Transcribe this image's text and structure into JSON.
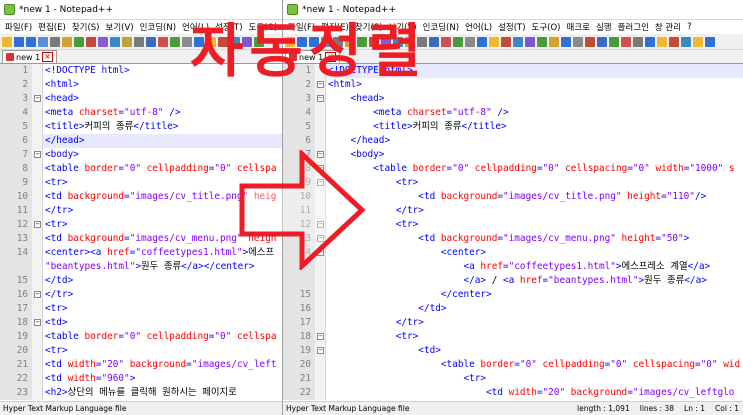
{
  "left_window": {
    "title": "*new 1 - Notepad++",
    "menu": [
      "파일(F)",
      "편집(E)",
      "찾기(S)",
      "보기(V)",
      "인코딩(N)",
      "언어(L)",
      "설정(T)",
      "도구(O)"
    ],
    "tab": "new 1",
    "lines": [
      {
        "n": "1",
        "segs": [
          {
            "t": "tag",
            "v": "<!DOCTYPE html>"
          }
        ]
      },
      {
        "n": "2",
        "segs": [
          {
            "t": "tag",
            "v": "<html>"
          }
        ]
      },
      {
        "n": "3",
        "segs": [
          {
            "t": "tag",
            "v": "<head>"
          }
        ]
      },
      {
        "n": "4",
        "segs": [
          {
            "t": "tag",
            "v": "<meta "
          },
          {
            "t": "attr",
            "v": "charset"
          },
          {
            "t": "tag",
            "v": "="
          },
          {
            "t": "val",
            "v": "\"utf-8\""
          },
          {
            "t": "tag",
            "v": " />"
          }
        ]
      },
      {
        "n": "5",
        "segs": [
          {
            "t": "tag",
            "v": "<title>"
          },
          {
            "t": "txt",
            "v": "커피의 종류"
          },
          {
            "t": "tag",
            "v": "</title>"
          }
        ]
      },
      {
        "n": "6",
        "segs": [
          {
            "t": "tag",
            "v": "</head>"
          }
        ]
      },
      {
        "n": "7",
        "segs": [
          {
            "t": "tag",
            "v": "<body>"
          }
        ]
      },
      {
        "n": "8",
        "segs": [
          {
            "t": "tag",
            "v": "<table "
          },
          {
            "t": "attr",
            "v": "border"
          },
          {
            "t": "tag",
            "v": "="
          },
          {
            "t": "val",
            "v": "\"0\""
          },
          {
            "t": "tag",
            "v": " "
          },
          {
            "t": "attr",
            "v": "cellpadding"
          },
          {
            "t": "tag",
            "v": "="
          },
          {
            "t": "val",
            "v": "\"0\""
          },
          {
            "t": "tag",
            "v": " "
          },
          {
            "t": "attr",
            "v": "cellspa"
          }
        ]
      },
      {
        "n": "9",
        "segs": [
          {
            "t": "tag",
            "v": "<tr>"
          }
        ]
      },
      {
        "n": "10",
        "segs": [
          {
            "t": "tag",
            "v": "<td "
          },
          {
            "t": "attr",
            "v": "background"
          },
          {
            "t": "tag",
            "v": "="
          },
          {
            "t": "val",
            "v": "\"images/cv_title.png\""
          },
          {
            "t": "tag",
            "v": " "
          },
          {
            "t": "attr",
            "v": "heig"
          }
        ]
      },
      {
        "n": "11",
        "segs": [
          {
            "t": "tag",
            "v": "</tr>"
          }
        ]
      },
      {
        "n": "12",
        "segs": [
          {
            "t": "tag",
            "v": "<tr>"
          }
        ]
      },
      {
        "n": "13",
        "segs": [
          {
            "t": "tag",
            "v": "<td "
          },
          {
            "t": "attr",
            "v": "background"
          },
          {
            "t": "tag",
            "v": "="
          },
          {
            "t": "val",
            "v": "\"images/cv_menu.png\""
          },
          {
            "t": "tag",
            "v": " "
          },
          {
            "t": "attr",
            "v": "heigh"
          }
        ]
      },
      {
        "n": "14",
        "segs": [
          {
            "t": "tag",
            "v": "<center><a "
          },
          {
            "t": "attr",
            "v": "href"
          },
          {
            "t": "tag",
            "v": "="
          },
          {
            "t": "val",
            "v": "\"coffeetypes1.html\""
          },
          {
            "t": "tag",
            "v": ">"
          },
          {
            "t": "txt",
            "v": "에스프"
          }
        ]
      },
      {
        "n": "",
        "segs": [
          {
            "t": "val",
            "v": "\"beantypes.html\""
          },
          {
            "t": "tag",
            "v": ">"
          },
          {
            "t": "txt",
            "v": "원두 종류"
          },
          {
            "t": "tag",
            "v": "</a></center>"
          }
        ]
      },
      {
        "n": "15",
        "segs": [
          {
            "t": "tag",
            "v": "</td>"
          }
        ]
      },
      {
        "n": "16",
        "segs": [
          {
            "t": "tag",
            "v": "</tr>"
          }
        ]
      },
      {
        "n": "17",
        "segs": [
          {
            "t": "tag",
            "v": "<tr>"
          }
        ]
      },
      {
        "n": "18",
        "segs": [
          {
            "t": "tag",
            "v": "<td>"
          }
        ]
      },
      {
        "n": "19",
        "segs": [
          {
            "t": "tag",
            "v": "<table "
          },
          {
            "t": "attr",
            "v": "border"
          },
          {
            "t": "tag",
            "v": "="
          },
          {
            "t": "val",
            "v": "\"0\""
          },
          {
            "t": "tag",
            "v": " "
          },
          {
            "t": "attr",
            "v": "cellpadding"
          },
          {
            "t": "tag",
            "v": "="
          },
          {
            "t": "val",
            "v": "\"0\""
          },
          {
            "t": "tag",
            "v": " "
          },
          {
            "t": "attr",
            "v": "cellspa"
          }
        ]
      },
      {
        "n": "20",
        "segs": [
          {
            "t": "tag",
            "v": "<tr>"
          }
        ]
      },
      {
        "n": "21",
        "segs": [
          {
            "t": "tag",
            "v": "<td "
          },
          {
            "t": "attr",
            "v": "width"
          },
          {
            "t": "tag",
            "v": "="
          },
          {
            "t": "val",
            "v": "\"20\""
          },
          {
            "t": "tag",
            "v": " "
          },
          {
            "t": "attr",
            "v": "background"
          },
          {
            "t": "tag",
            "v": "="
          },
          {
            "t": "val",
            "v": "\"images/cv_left"
          }
        ]
      },
      {
        "n": "22",
        "segs": [
          {
            "t": "tag",
            "v": "<td "
          },
          {
            "t": "attr",
            "v": "width"
          },
          {
            "t": "tag",
            "v": "="
          },
          {
            "t": "val",
            "v": "\"960\""
          },
          {
            "t": "tag",
            "v": ">"
          }
        ]
      },
      {
        "n": "23",
        "segs": [
          {
            "t": "tag",
            "v": "<h2>"
          },
          {
            "t": "txt",
            "v": "상단의 메뉴를 클릭해 원하시는 페이지로"
          }
        ]
      }
    ],
    "status": "Hyper Text Markup Language file"
  },
  "right_window": {
    "title": "*new 1 - Notepad++",
    "menu": [
      "파일(F)",
      "편집(E)",
      "찾기(S)",
      "보기(V)",
      "인코딩(N)",
      "언어(L)",
      "설정(T)",
      "도구(O)",
      "매크로",
      "실행",
      "플러그인",
      "창 관리",
      "?"
    ],
    "tab": "new 1",
    "lines": [
      {
        "n": "1",
        "segs": [
          {
            "t": "tag",
            "v": "<!DOCTYPE html>"
          }
        ]
      },
      {
        "n": "2",
        "segs": [
          {
            "t": "tag",
            "v": "<html>"
          }
        ]
      },
      {
        "n": "3",
        "segs": [
          {
            "t": "tag",
            "v": "    <head>"
          }
        ]
      },
      {
        "n": "4",
        "segs": [
          {
            "t": "tag",
            "v": "        <meta "
          },
          {
            "t": "attr",
            "v": "charset"
          },
          {
            "t": "tag",
            "v": "="
          },
          {
            "t": "val",
            "v": "\"utf-8\""
          },
          {
            "t": "tag",
            "v": " />"
          }
        ]
      },
      {
        "n": "5",
        "segs": [
          {
            "t": "tag",
            "v": "        <title>"
          },
          {
            "t": "txt",
            "v": "커피의 종류"
          },
          {
            "t": "tag",
            "v": "</title>"
          }
        ]
      },
      {
        "n": "6",
        "segs": [
          {
            "t": "tag",
            "v": "    </head>"
          }
        ]
      },
      {
        "n": "7",
        "segs": [
          {
            "t": "tag",
            "v": "    <body>"
          }
        ]
      },
      {
        "n": "8",
        "segs": [
          {
            "t": "tag",
            "v": "        <table "
          },
          {
            "t": "attr",
            "v": "border"
          },
          {
            "t": "tag",
            "v": "="
          },
          {
            "t": "val",
            "v": "\"0\""
          },
          {
            "t": "tag",
            "v": " "
          },
          {
            "t": "attr",
            "v": "cellpadding"
          },
          {
            "t": "tag",
            "v": "="
          },
          {
            "t": "val",
            "v": "\"0\""
          },
          {
            "t": "tag",
            "v": " "
          },
          {
            "t": "attr",
            "v": "cellspacing"
          },
          {
            "t": "tag",
            "v": "="
          },
          {
            "t": "val",
            "v": "\"0\""
          },
          {
            "t": "tag",
            "v": " "
          },
          {
            "t": "attr",
            "v": "width"
          },
          {
            "t": "tag",
            "v": "="
          },
          {
            "t": "val",
            "v": "\"1000\""
          },
          {
            "t": "tag",
            "v": " "
          },
          {
            "t": "attr",
            "v": "s"
          }
        ]
      },
      {
        "n": "9",
        "segs": [
          {
            "t": "tag",
            "v": "            <tr>"
          }
        ]
      },
      {
        "n": "10",
        "segs": [
          {
            "t": "tag",
            "v": "                <td "
          },
          {
            "t": "attr",
            "v": "background"
          },
          {
            "t": "tag",
            "v": "="
          },
          {
            "t": "val",
            "v": "\"images/cv_title.png\""
          },
          {
            "t": "tag",
            "v": " "
          },
          {
            "t": "attr",
            "v": "height"
          },
          {
            "t": "tag",
            "v": "="
          },
          {
            "t": "val",
            "v": "\"110\""
          },
          {
            "t": "tag",
            "v": "/>"
          }
        ]
      },
      {
        "n": "11",
        "segs": [
          {
            "t": "tag",
            "v": "            </tr>"
          }
        ]
      },
      {
        "n": "12",
        "segs": [
          {
            "t": "tag",
            "v": "            <tr>"
          }
        ]
      },
      {
        "n": "13",
        "segs": [
          {
            "t": "tag",
            "v": "                <td "
          },
          {
            "t": "attr",
            "v": "background"
          },
          {
            "t": "tag",
            "v": "="
          },
          {
            "t": "val",
            "v": "\"images/cv_menu.png\""
          },
          {
            "t": "tag",
            "v": " "
          },
          {
            "t": "attr",
            "v": "height"
          },
          {
            "t": "tag",
            "v": "="
          },
          {
            "t": "val",
            "v": "\"50\""
          },
          {
            "t": "tag",
            "v": ">"
          }
        ]
      },
      {
        "n": "14",
        "segs": [
          {
            "t": "tag",
            "v": "                    <center>"
          }
        ]
      },
      {
        "n": "",
        "segs": [
          {
            "t": "tag",
            "v": "                        <a "
          },
          {
            "t": "attr",
            "v": "href"
          },
          {
            "t": "tag",
            "v": "="
          },
          {
            "t": "val",
            "v": "\"coffeetypes1.html\""
          },
          {
            "t": "tag",
            "v": ">"
          },
          {
            "t": "txt",
            "v": "에스프레소 계열"
          },
          {
            "t": "tag",
            "v": "</a>"
          }
        ]
      },
      {
        "n": "",
        "segs": [
          {
            "t": "tag",
            "v": "                        </a>"
          },
          {
            "t": "txt",
            "v": " / "
          },
          {
            "t": "tag",
            "v": "<a "
          },
          {
            "t": "attr",
            "v": "href"
          },
          {
            "t": "tag",
            "v": "="
          },
          {
            "t": "val",
            "v": "\"beantypes.html\""
          },
          {
            "t": "tag",
            "v": ">"
          },
          {
            "t": "txt",
            "v": "원두 종류"
          },
          {
            "t": "tag",
            "v": "</a>"
          }
        ]
      },
      {
        "n": "15",
        "segs": [
          {
            "t": "tag",
            "v": "                    </center>"
          }
        ]
      },
      {
        "n": "16",
        "segs": [
          {
            "t": "tag",
            "v": "                </td>"
          }
        ]
      },
      {
        "n": "17",
        "segs": [
          {
            "t": "tag",
            "v": "            </tr>"
          }
        ]
      },
      {
        "n": "18",
        "segs": [
          {
            "t": "tag",
            "v": "            <tr>"
          }
        ]
      },
      {
        "n": "19",
        "segs": [
          {
            "t": "tag",
            "v": "                <td>"
          }
        ]
      },
      {
        "n": "20",
        "segs": [
          {
            "t": "tag",
            "v": "                    <table "
          },
          {
            "t": "attr",
            "v": "border"
          },
          {
            "t": "tag",
            "v": "="
          },
          {
            "t": "val",
            "v": "\"0\""
          },
          {
            "t": "tag",
            "v": " "
          },
          {
            "t": "attr",
            "v": "cellpadding"
          },
          {
            "t": "tag",
            "v": "="
          },
          {
            "t": "val",
            "v": "\"0\""
          },
          {
            "t": "tag",
            "v": " "
          },
          {
            "t": "attr",
            "v": "cellspacing"
          },
          {
            "t": "tag",
            "v": "="
          },
          {
            "t": "val",
            "v": "\"0\""
          },
          {
            "t": "tag",
            "v": " "
          },
          {
            "t": "attr",
            "v": "wid"
          }
        ]
      },
      {
        "n": "21",
        "segs": [
          {
            "t": "tag",
            "v": "                        <tr>"
          }
        ]
      },
      {
        "n": "22",
        "segs": [
          {
            "t": "tag",
            "v": "                            <td "
          },
          {
            "t": "attr",
            "v": "width"
          },
          {
            "t": "tag",
            "v": "="
          },
          {
            "t": "val",
            "v": "\"20\""
          },
          {
            "t": "tag",
            "v": " "
          },
          {
            "t": "attr",
            "v": "background"
          },
          {
            "t": "tag",
            "v": "="
          },
          {
            "t": "val",
            "v": "\"images/cv_leftglo"
          }
        ]
      }
    ],
    "status": "Hyper Text Markup Language file",
    "status_length": "length : 1,091",
    "status_lines": "lines : 38",
    "status_ln": "Ln : 1",
    "status_col": "Col : 1"
  },
  "overlay": {
    "title": "자동정렬",
    "accent_color": "#ee1c25"
  }
}
